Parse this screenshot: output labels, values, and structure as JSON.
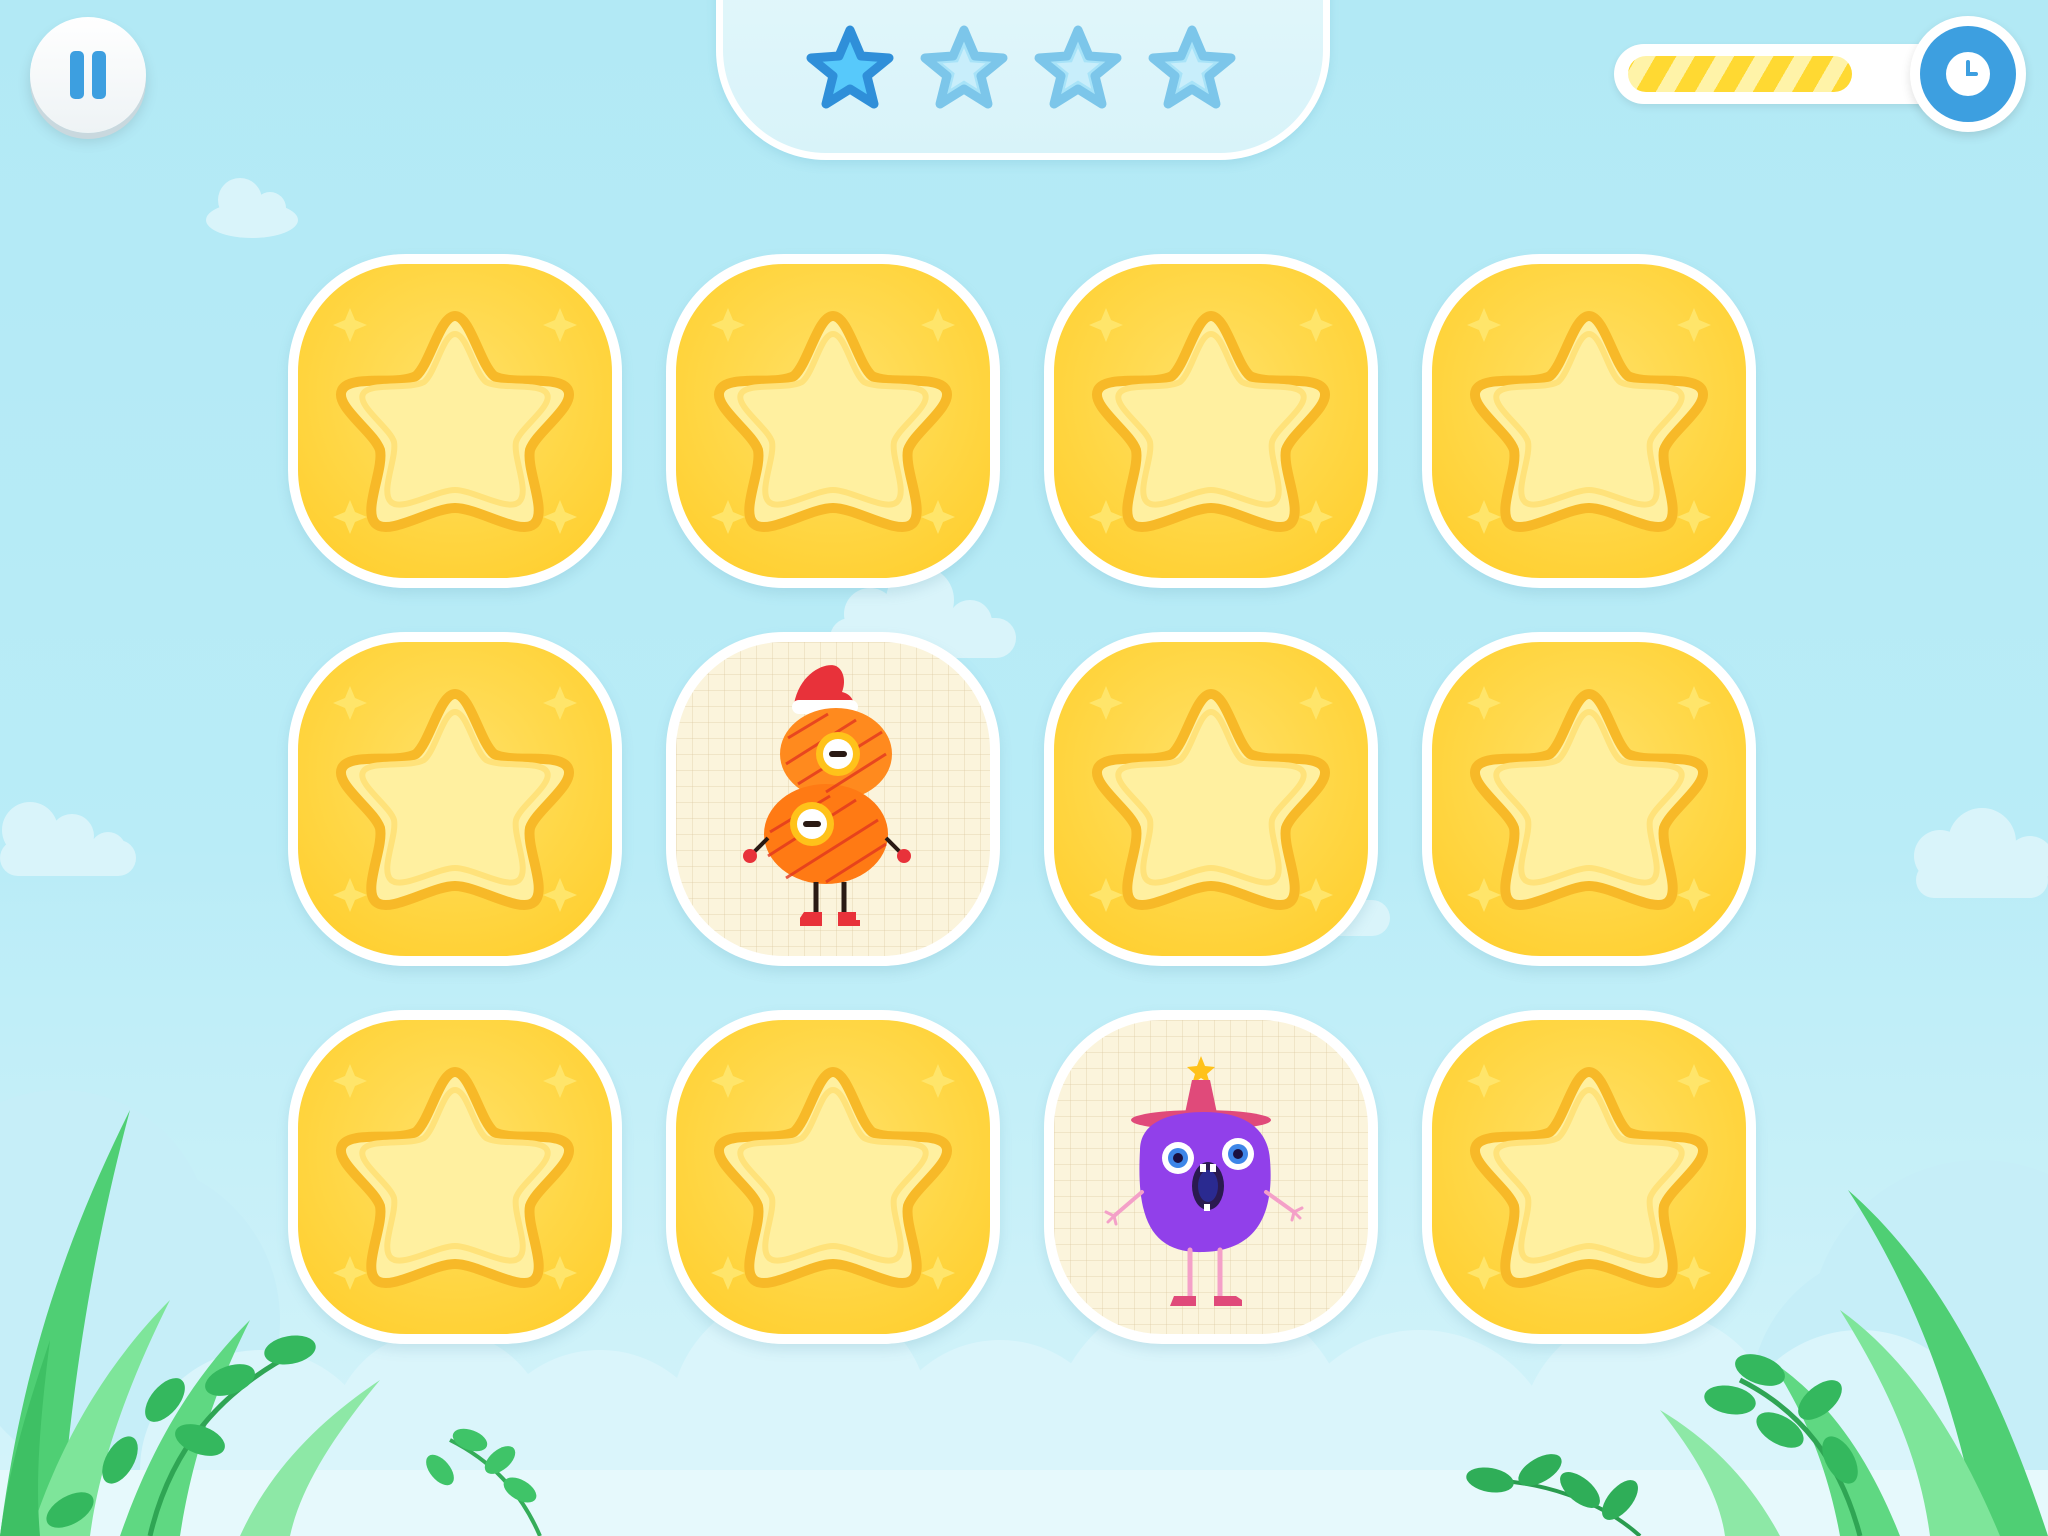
{
  "screen": {
    "name": "memory-match-game",
    "background_color": "#b5eaf6",
    "accent_blue": "#3d9fe0",
    "card_yellow": "#ffd643"
  },
  "hud": {
    "pause_button": {
      "icon": "pause-icon"
    },
    "stars": {
      "earned": 1,
      "total": 4,
      "icon": "star-icon"
    },
    "timer": {
      "icon": "clock-icon",
      "remaining_fraction": 0.8
    }
  },
  "board": {
    "rows": 3,
    "cols": 4,
    "cards": [
      {
        "face": "back"
      },
      {
        "face": "back"
      },
      {
        "face": "back"
      },
      {
        "face": "back"
      },
      {
        "face": "back"
      },
      {
        "face": "up",
        "character": "number-eight-monster-with-santa-hat"
      },
      {
        "face": "back"
      },
      {
        "face": "back"
      },
      {
        "face": "back"
      },
      {
        "face": "back"
      },
      {
        "face": "up",
        "character": "purple-monster-with-wizard-hat"
      },
      {
        "face": "back"
      }
    ]
  }
}
